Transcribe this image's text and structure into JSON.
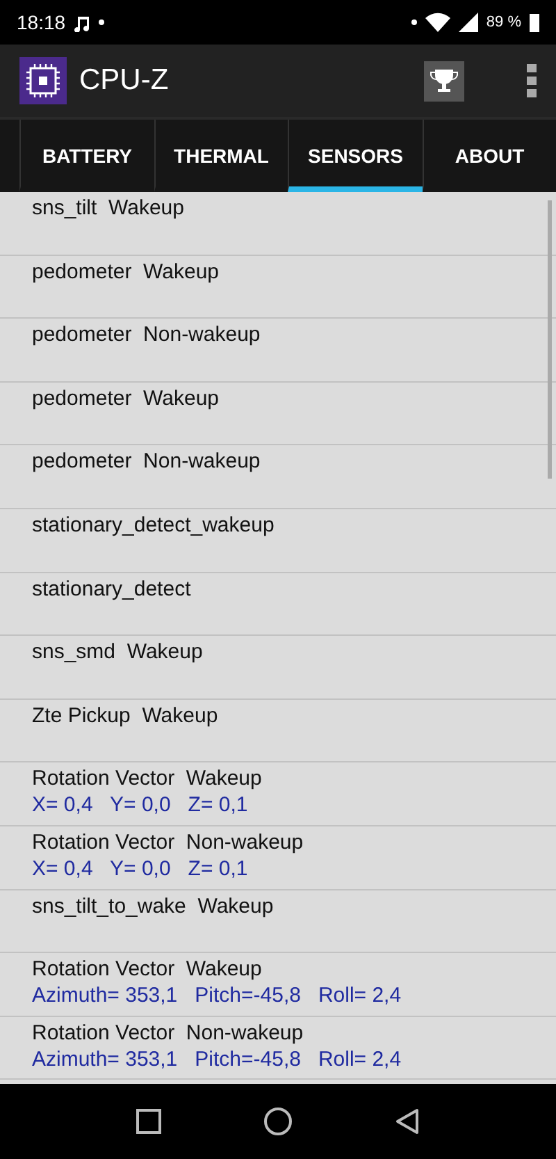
{
  "status_bar": {
    "time": "18:18",
    "battery": "89 %"
  },
  "app_bar": {
    "title": "CPU-Z"
  },
  "tabs": [
    {
      "label": "BATTERY",
      "selected": false
    },
    {
      "label": "THERMAL",
      "selected": false
    },
    {
      "label": "SENSORS",
      "selected": true
    },
    {
      "label": "ABOUT",
      "selected": false
    }
  ],
  "sensors": [
    {
      "name": "sns_tilt  Wakeup"
    },
    {
      "name": "pedometer  Wakeup"
    },
    {
      "name": "pedometer  Non-wakeup"
    },
    {
      "name": "pedometer  Wakeup"
    },
    {
      "name": "pedometer  Non-wakeup"
    },
    {
      "name": "stationary_detect_wakeup"
    },
    {
      "name": "stationary_detect"
    },
    {
      "name": "sns_smd  Wakeup"
    },
    {
      "name": "Zte Pickup  Wakeup"
    },
    {
      "name": "Rotation Vector  Wakeup",
      "value": "X= 0,4   Y= 0,0   Z= 0,1"
    },
    {
      "name": "Rotation Vector  Non-wakeup",
      "value": "X= 0,4   Y= 0,0   Z= 0,1"
    },
    {
      "name": "sns_tilt_to_wake  Wakeup"
    },
    {
      "name": "Rotation Vector  Wakeup",
      "value": "Azimuth= 353,1   Pitch=-45,8   Roll= 2,4"
    },
    {
      "name": "Rotation Vector  Non-wakeup",
      "value": "Azimuth= 353,1   Pitch=-45,8   Roll= 2,4"
    }
  ]
}
